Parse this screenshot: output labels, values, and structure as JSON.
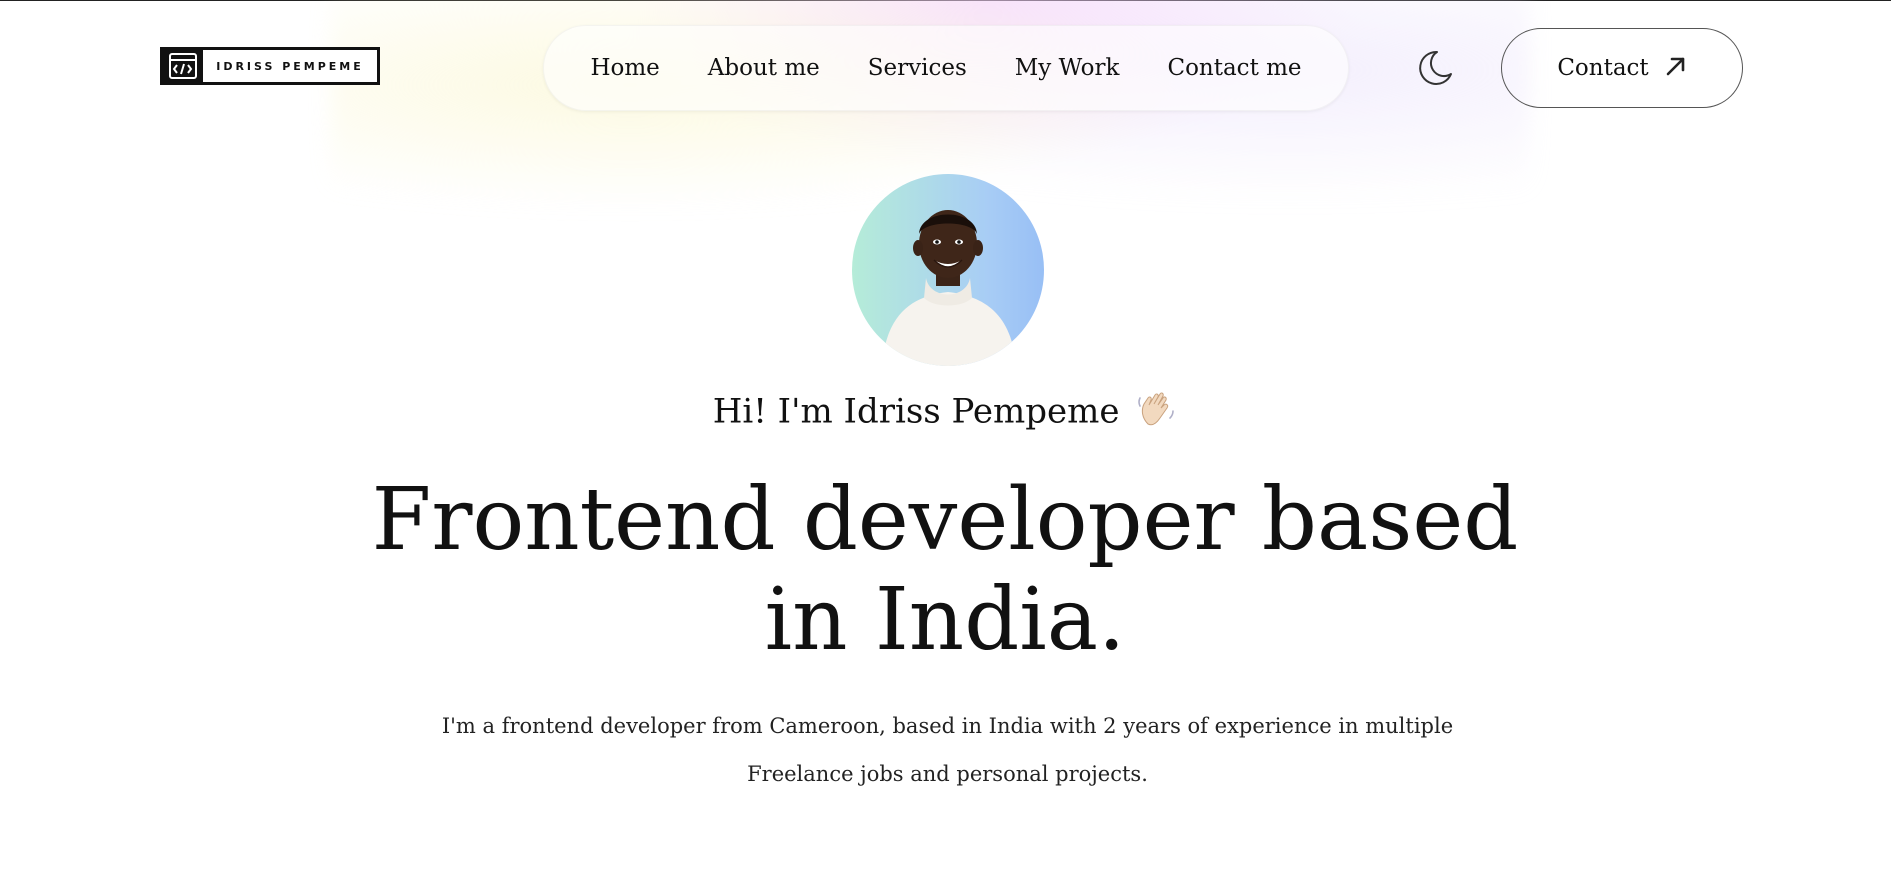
{
  "header": {
    "logo_text": "IDRISS PEMPEME",
    "nav_items": [
      {
        "label": "Home"
      },
      {
        "label": "About me"
      },
      {
        "label": "Services"
      },
      {
        "label": "My Work"
      },
      {
        "label": "Contact me"
      }
    ],
    "theme_toggle_icon": "moon-icon",
    "contact_button_label": "Contact",
    "contact_button_icon": "arrow-up-right-icon"
  },
  "hero": {
    "greeting": "Hi! I'm Idriss Pempeme",
    "greeting_emoji": "waving-hand-icon",
    "headline_line1": "Frontend developer based",
    "headline_line2": "in India.",
    "intro": "I'm a frontend developer from Cameroon, based in India with 2 years of experience in multiple Freelance jobs and personal projects."
  }
}
